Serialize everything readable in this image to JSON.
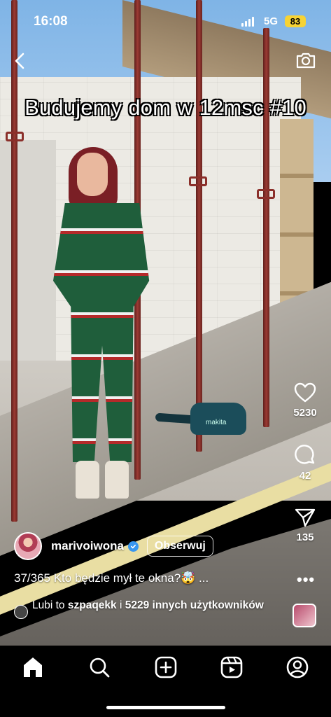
{
  "status_bar": {
    "time": "16:08",
    "network": "5G",
    "battery": "83"
  },
  "reel": {
    "title": "Budujemy dom w 12msc #10",
    "author": {
      "username": "marivoiwona",
      "verified": true,
      "follow_label": "Obserwuj"
    },
    "caption": "37/365 Kto będzie mył te okna?🤯 ...",
    "liked_by": {
      "prefix": "Lubi to ",
      "user": "szpaqekk",
      "middle": " i ",
      "others": "5229 innych użytkowników"
    },
    "tool_brand": "makita"
  },
  "actions": {
    "likes": "5230",
    "comments": "42",
    "shares": "135"
  },
  "nav": {
    "items": [
      "home-icon",
      "search-icon",
      "create-icon",
      "reels-icon",
      "profile-icon"
    ],
    "active": "home-icon"
  },
  "colors": {
    "background": "#000000",
    "verified": "#3897f0",
    "battery": "#f7d335"
  }
}
